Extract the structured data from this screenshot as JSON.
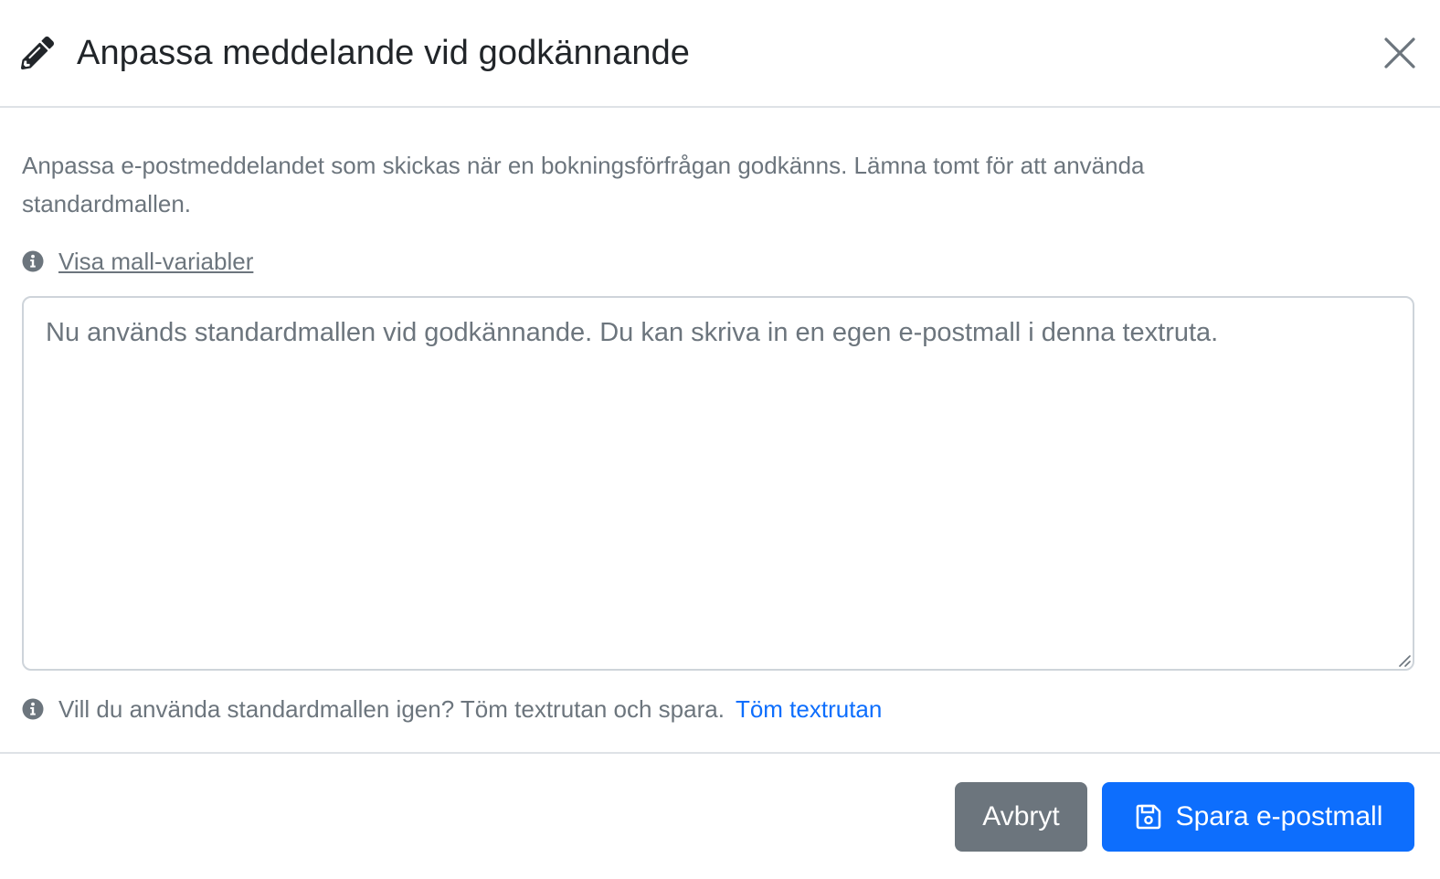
{
  "header": {
    "icon": "pencil-icon",
    "title": "Anpassa meddelande vid godkännande",
    "close_icon": "close-icon"
  },
  "body": {
    "description": "Anpassa e-postmeddelandet som skickas när en bokningsförfrågan godkänns. Lämna tomt för att använda standardmallen.",
    "variables_link": "Visa mall-variabler",
    "textarea": {
      "value": "",
      "placeholder": "Nu används standardmallen vid godkännande. Du kan skriva in en egen e-postmall i denna textruta."
    },
    "hint_text": "Vill du använda standardmallen igen? Töm textrutan och spara.",
    "clear_link": "Töm textrutan"
  },
  "footer": {
    "cancel_label": "Avbryt",
    "save_label": "Spara e-postmall",
    "save_icon": "floppy-disk-icon"
  },
  "colors": {
    "primary": "#0d6efd",
    "secondary": "#6c757d",
    "text": "#212529",
    "muted": "#6c757d",
    "border": "#dee2e6"
  }
}
